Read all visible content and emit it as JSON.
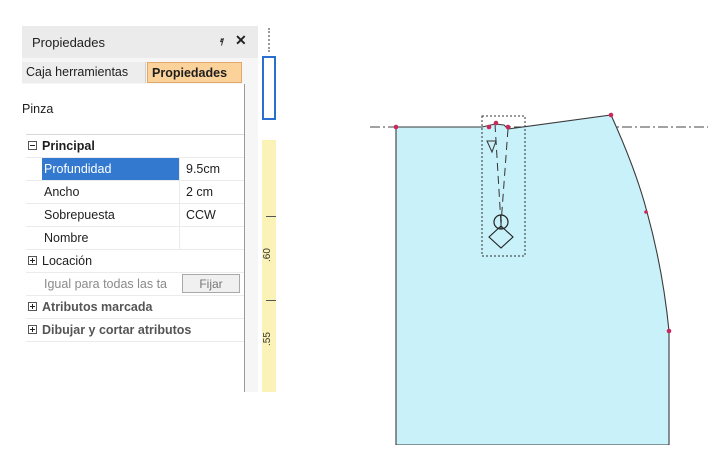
{
  "panel": {
    "title": "Propiedades",
    "pin_glyph": "Ȣ",
    "close_glyph": "✕",
    "tabs": [
      {
        "label": "Caja herramientas",
        "active": false
      },
      {
        "label": "Propiedades",
        "active": true
      }
    ],
    "object_name": "Pinza",
    "categories": {
      "principal": {
        "label": "Principal",
        "expanded": true,
        "properties": [
          {
            "name": "Profundidad",
            "value": "9.5cm",
            "selected": true
          },
          {
            "name": "Ancho",
            "value": "2 cm"
          },
          {
            "name": "Sobrepuesta",
            "value": "CCW"
          },
          {
            "name": "Nombre",
            "value": ""
          }
        ]
      },
      "locacion": {
        "label": "Locación",
        "expanded": false
      },
      "igual_row": {
        "label": "Igual para todas las ta",
        "button": "Fijar"
      },
      "atributos": {
        "label": "Atributos marcada",
        "expanded": false
      },
      "dibujar": {
        "label": "Dibujar y cortar atributos",
        "expanded": false
      }
    }
  },
  "ruler": {
    "labels": [
      ".60",
      ".55"
    ]
  },
  "colors": {
    "panel_tab_active": "#fbd299",
    "selection": "#3379cf",
    "piece_fill": "#c8f1fa",
    "piece_outline": "#3a3a3a",
    "point": "#c8285a",
    "ruler_fill": "#fbf2b7",
    "ruler_frame": "#2a6fd0"
  },
  "icons": {
    "pin": "pin-icon",
    "close": "close-icon",
    "expand_minus": "collapse-icon",
    "expand_plus": "expand-icon"
  }
}
